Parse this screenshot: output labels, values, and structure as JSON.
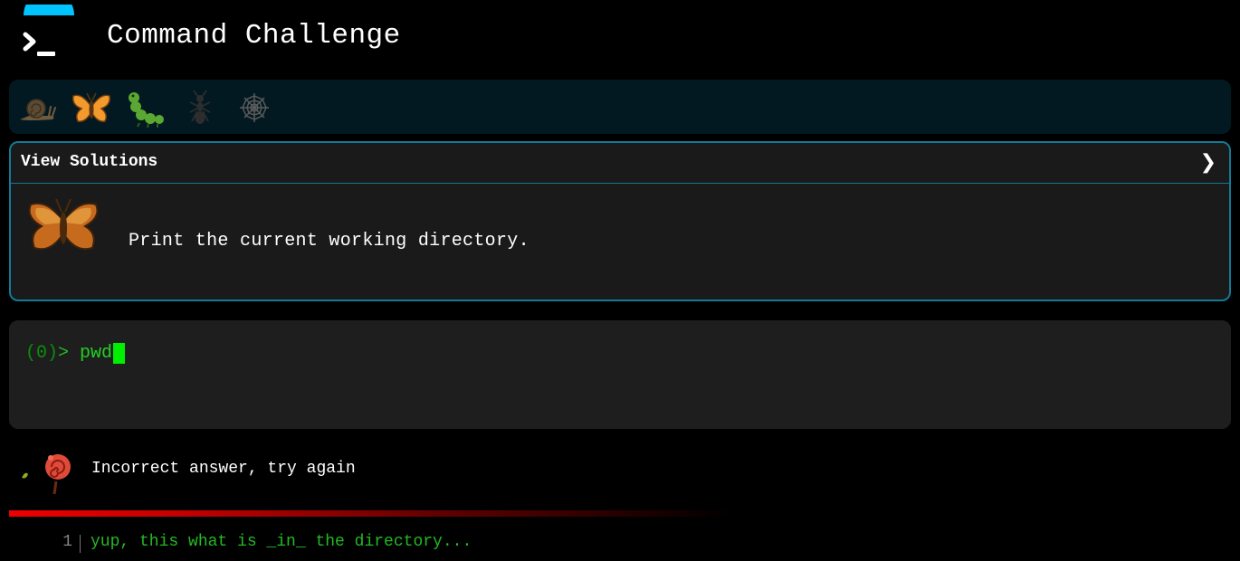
{
  "header": {
    "title": "Command Challenge",
    "logo_icon": "terminal-prompt-icon",
    "accent_color": "#00c4ff"
  },
  "levels": [
    {
      "icon": "snail-icon",
      "state": "completed"
    },
    {
      "icon": "butterfly-icon",
      "state": "current"
    },
    {
      "icon": "caterpillar-icon",
      "state": "locked"
    },
    {
      "icon": "ant-icon",
      "state": "locked"
    },
    {
      "icon": "spider-web-icon",
      "state": "locked"
    }
  ],
  "challenge": {
    "view_solutions_label": "View Solutions",
    "expand_icon": "chevron-right-icon",
    "icon": "butterfly-icon",
    "text": "Print the current working directory.",
    "border_color": "#117a96"
  },
  "terminal": {
    "count": "(0)",
    "prompt": ">",
    "input": "pwd"
  },
  "result": {
    "icon": "wilted-rose-icon",
    "message": "Incorrect answer, try again",
    "bar_color": "#ee0000"
  },
  "output": {
    "lines": [
      {
        "number": "1",
        "text": "yup, this what is _in_ the directory..."
      }
    ]
  }
}
